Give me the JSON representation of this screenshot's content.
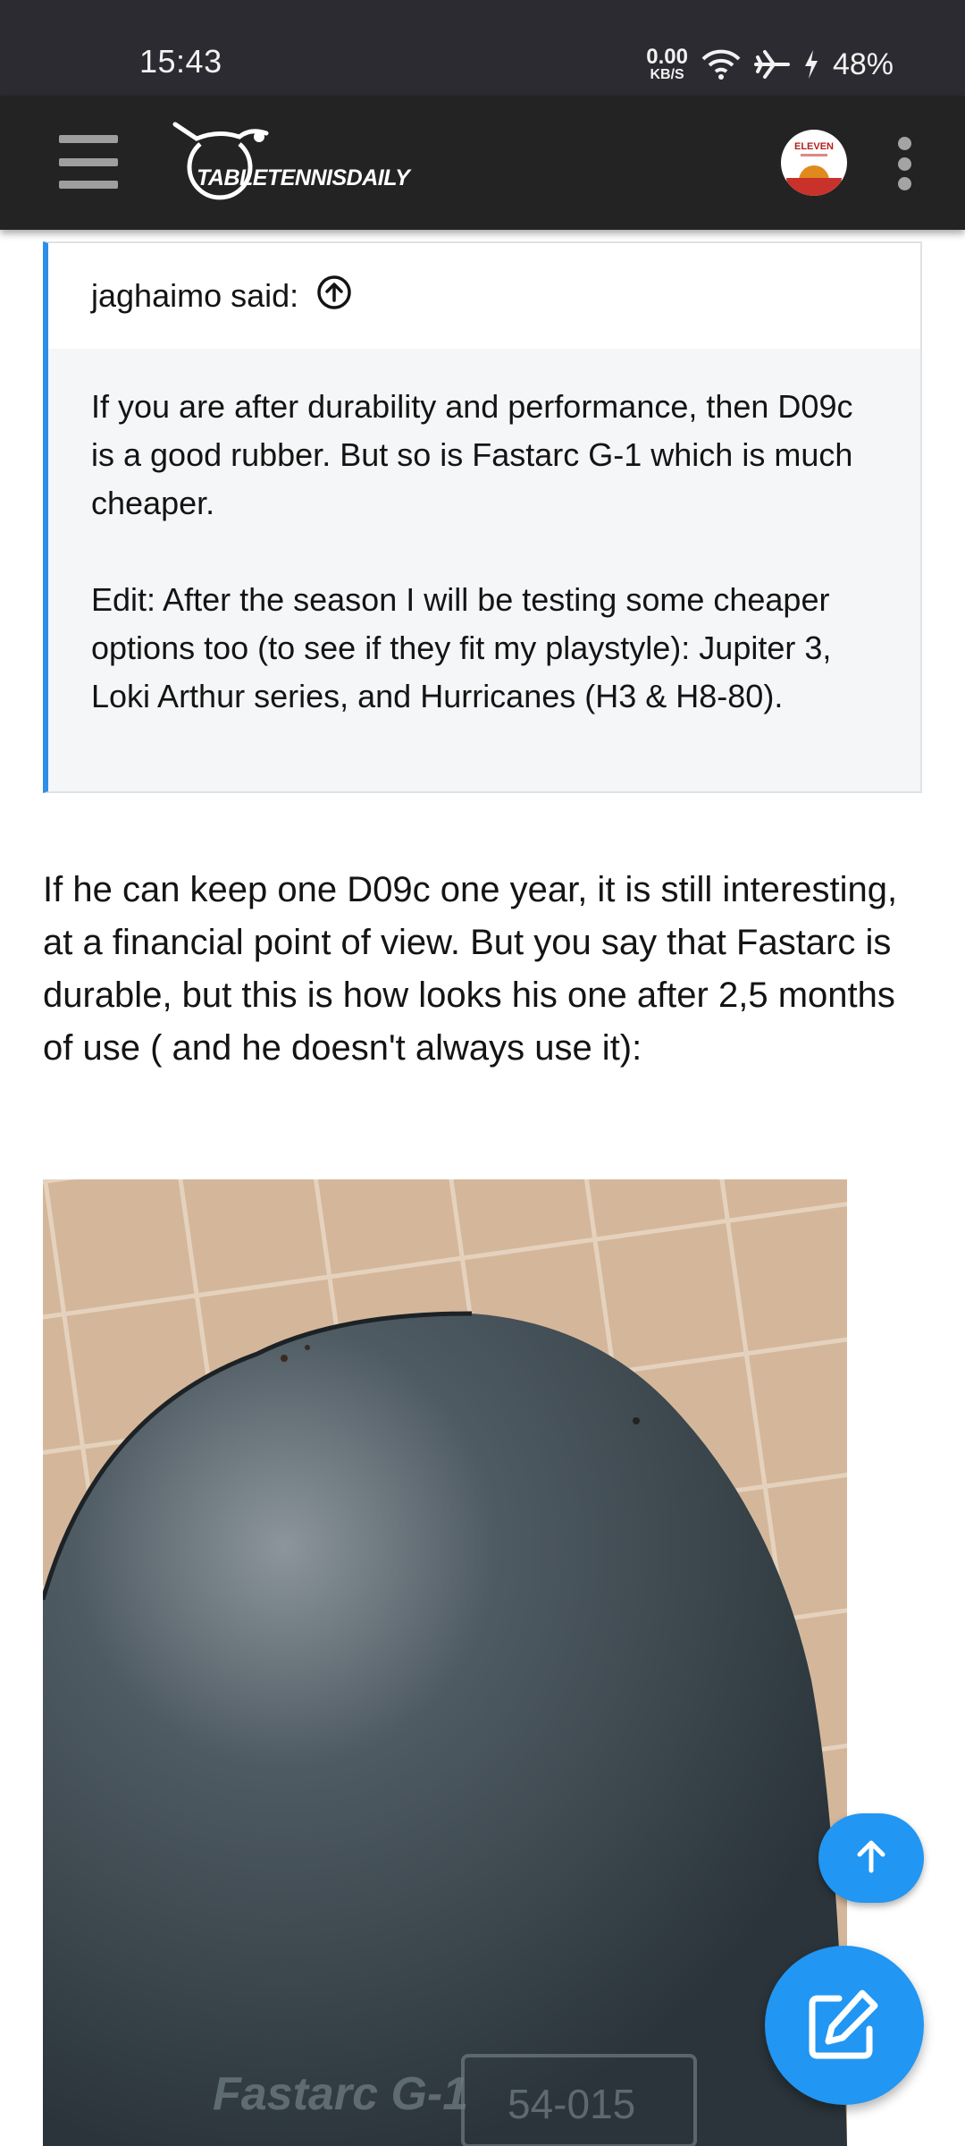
{
  "status_bar": {
    "time": "15:43",
    "net_speed_value": "0.00",
    "net_speed_unit": "KB/S",
    "battery": "48%",
    "icons": [
      "wifi-icon",
      "airplane-mode-icon",
      "charging-icon"
    ]
  },
  "header": {
    "logo_text": "TABLETENNISDAILY",
    "avatar_text": "ELEVEN",
    "icons": [
      "menu-icon",
      "more-vert-icon"
    ]
  },
  "quote": {
    "author_line": "jaghaimo said:",
    "paragraphs": [
      "If you are after durability and performance, then D09c is a good rubber. But so is Fastarc G-1 which is much cheaper.",
      "Edit: After the season I will be testing some cheaper options too (to see if they fit my playstyle): Jupiter 3, Loki Arthur series, and Hurricanes (H3 & H8-80)."
    ]
  },
  "post": {
    "text": "If he can keep one D09c one year, it is still interesting, at a financial point of view. But you say that Fastarc is durable, but this is how looks his one after 2,5 months of use ( and he doesn't always use it):"
  },
  "image": {
    "printed_text_1": "Fastarc G-1",
    "printed_text_2": "54-015"
  },
  "floating": {
    "icons": [
      "arrow-up-icon",
      "edit-icon"
    ]
  },
  "colors": {
    "accent": "#2196f3",
    "quote_bar": "#2f8fe6",
    "header_bg": "#232323",
    "status_bg": "#2b2b31"
  }
}
